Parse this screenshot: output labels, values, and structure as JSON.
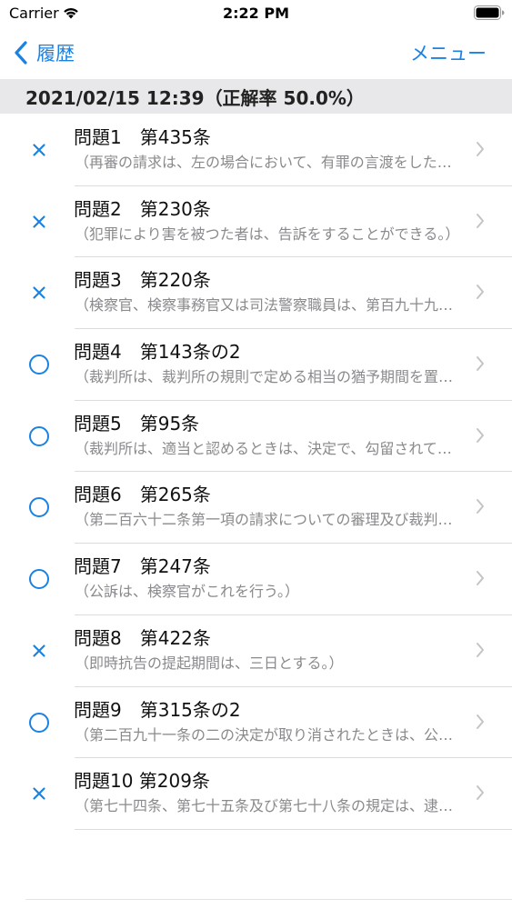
{
  "status_bar": {
    "carrier": "Carrier",
    "time": "2:22 PM"
  },
  "nav": {
    "back_label": "履歴",
    "menu_label": "メニュー"
  },
  "section": {
    "header": "2021/02/15 12:39（正解率 50.0%）"
  },
  "colors": {
    "accent": "#1a82e2",
    "header_bg": "#e8e8ea",
    "subtitle": "#8a8a8e"
  },
  "rows": [
    {
      "result": "incorrect",
      "icon": "cross-icon",
      "title": "問題1　第435条",
      "subtitle": "（再審の請求は、左の場合において、有罪の言渡をした確定判決に対して、その言渡を受けた者の利益のために、これをすることができる。）"
    },
    {
      "result": "incorrect",
      "icon": "cross-icon",
      "title": "問題2　第230条",
      "subtitle": "（犯罪により害を被つた者は、告訴をすることができる。）"
    },
    {
      "result": "incorrect",
      "icon": "cross-icon",
      "title": "問題3　第220条",
      "subtitle": "（検察官、検察事務官又は司法警察職員は、第百九十九条の規定により被疑者を逮捕する場合において必要があるときは、左の処分をすることができる。）"
    },
    {
      "result": "correct",
      "icon": "circle-icon",
      "title": "問題4　第143条の2",
      "subtitle": "（裁判所は、裁判所の規則で定める相当の猶予期間を置いて、出頭すべき日時及び場所を定めて、証人を召喚することができる。）"
    },
    {
      "result": "correct",
      "icon": "circle-icon",
      "title": "問題5　第95条",
      "subtitle": "（裁判所は、適当と認めるときは、決定で、勾留されている被告人を親族、保護団体その他の者に委託し、又は被告人の住居を制限して、勾留の執行を停止することができる。）"
    },
    {
      "result": "correct",
      "icon": "circle-icon",
      "title": "問題6　第265条",
      "subtitle": "（第二百六十二条第一項の請求についての審理及び裁判は、合議体でこれをしなければならない。）"
    },
    {
      "result": "correct",
      "icon": "circle-icon",
      "title": "問題7　第247条",
      "subtitle": "（公訴は、検察官がこれを行う。）"
    },
    {
      "result": "incorrect",
      "icon": "cross-icon",
      "title": "問題8　第422条",
      "subtitle": "（即時抗告の提起期間は、三日とする。）"
    },
    {
      "result": "correct",
      "icon": "circle-icon",
      "title": "問題9　第315条の2",
      "subtitle": "（第二百九十一条の二の決定が取り消されたときは、公判手続を更新しなければならない。）"
    },
    {
      "result": "incorrect",
      "icon": "cross-icon",
      "title": "問題10 第209条",
      "subtitle": "（第七十四条、第七十五条及び第七十八条の規定は、逮捕状による逮捕についてこれを準用する。）"
    }
  ]
}
